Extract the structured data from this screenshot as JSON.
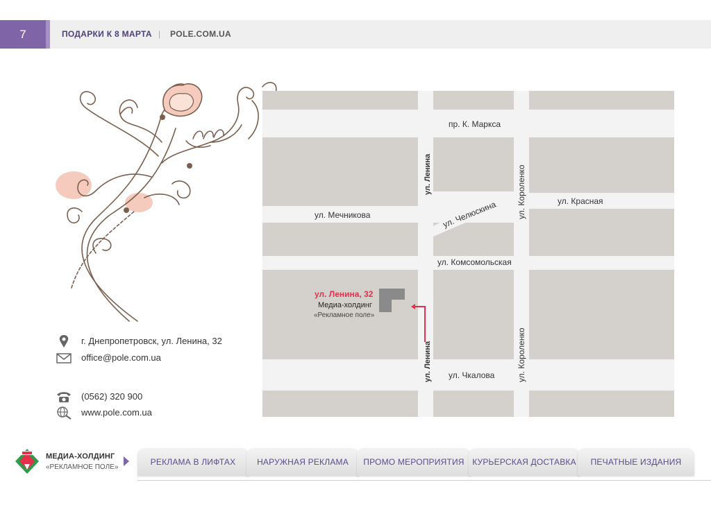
{
  "header": {
    "page_number": "7",
    "title": "ПОДАРКИ К 8 МАРТА",
    "separator": "|",
    "site": "POLE.COM.UA"
  },
  "map": {
    "streets": {
      "k_marksa": "пр. К. Маркса",
      "lenina_top": "ул. Ленина",
      "lenina_bottom": "ул. Ленина",
      "korolenko_top": "ул. Короленко",
      "korolenko_bottom": "ул. Короленко",
      "krasnaya": "ул. Красная",
      "chelyuskina": "ул. Челюскина",
      "mechnikova": "ул. Мечникова",
      "komsomolskaya": "ул. Комсомольская",
      "chkalova": "ул. Чкалова"
    },
    "marker": {
      "address": "ул. Ленина, 32",
      "company": "Медиа-холдинг",
      "company_sub": "«Рекламное поле»"
    }
  },
  "contacts": {
    "address": "г. Днепропетровск, ул. Ленина, 32",
    "email": "office@pole.com.ua",
    "phone": "(0562) 320 900",
    "website": "www.pole.com.ua",
    "icons": [
      "location-pin-icon",
      "envelope-icon",
      "telephone-icon",
      "globe-icon"
    ]
  },
  "footer": {
    "brand": "МЕДИА-ХОЛДИНГ",
    "brand_sub": "«РЕКЛАМНОЕ ПОЛЕ»",
    "tabs": [
      "РЕКЛАМА В ЛИФТАХ",
      "НАРУЖНАЯ РЕКЛАМА",
      "ПРОМО МЕРОПРИЯТИЯ",
      "КУРЬЕРСКАЯ ДОСТАВКА",
      "ПЕЧАТНЫЕ ИЗДАНИЯ"
    ]
  },
  "colors": {
    "accent_purple": "#7f64a8",
    "marker_red": "#e5304d",
    "map_block": "#d4d1cc",
    "map_road": "#f3f3f3",
    "ornament_brown": "#7a5f4e",
    "ornament_peach": "#f5cbbd"
  }
}
